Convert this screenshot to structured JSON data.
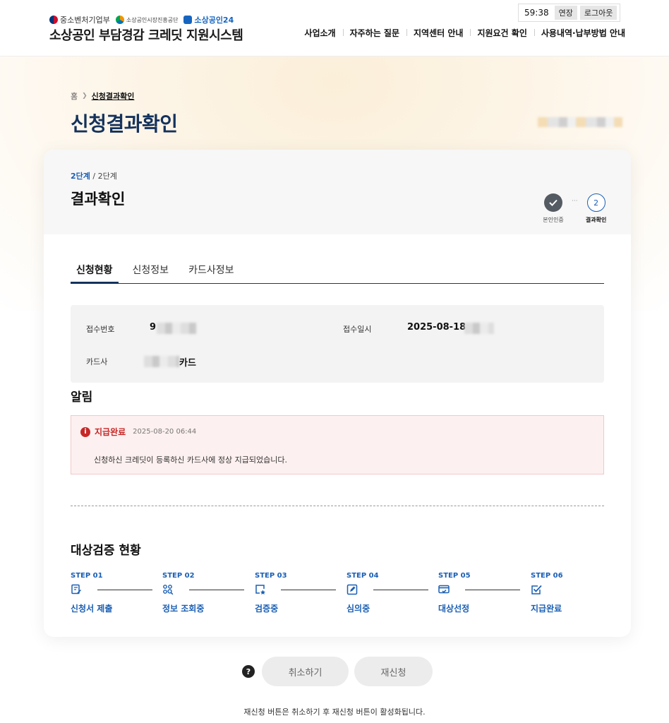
{
  "header": {
    "logos": {
      "ministry": "중소벤처기업부",
      "agency": "소상공인시장진흥공단",
      "portal": "소상공인24"
    },
    "site_title": "소상공인 부담경감 크레딧 지원시스템",
    "session": {
      "timer": "59:38",
      "extend_label": "연장",
      "logout_label": "로그아웃"
    },
    "nav": [
      {
        "label": "사업소개"
      },
      {
        "label": "자주하는 질문"
      },
      {
        "label": "지역센터 안내"
      },
      {
        "label": "지원요건 확인"
      },
      {
        "label": "사용내역·납부방법 안내"
      }
    ]
  },
  "breadcrumb": {
    "home": "홈",
    "current": "신청결과확인"
  },
  "page_title": "신청결과확인",
  "card": {
    "step_current": "2단계",
    "step_total": " / 2단계",
    "title": "결과확인",
    "progress": [
      {
        "label": "본인인증",
        "state": "done",
        "icon": "check-icon"
      },
      {
        "label": "결과확인",
        "state": "current",
        "number": "2"
      }
    ],
    "tabs": [
      {
        "label": "신청현황",
        "active": true
      },
      {
        "label": "신청정보",
        "active": false
      },
      {
        "label": "카드사정보",
        "active": false
      }
    ],
    "info": {
      "receipt_no_label": "접수번호",
      "receipt_no_value": "9",
      "receipt_date_label": "접수일시",
      "receipt_date_value": "2025-08-18",
      "card_company_label": "카드사",
      "card_company_value": "카드"
    },
    "notice": {
      "title": "알림",
      "status": "지급완료",
      "timestamp": "2025-08-20 06:44",
      "message": "신청하신 크레딧이 등록하신 카드사에 정상 지급되었습니다."
    },
    "verification": {
      "title": "대상검증 현황",
      "steps": [
        {
          "no": "STEP 01",
          "label": "신청서 제출",
          "icon": "document-edit-icon"
        },
        {
          "no": "STEP 02",
          "label": "정보 조회중",
          "icon": "search-grid-icon"
        },
        {
          "no": "STEP 03",
          "label": "검증중",
          "icon": "verify-star-icon"
        },
        {
          "no": "STEP 04",
          "label": "심의중",
          "icon": "pen-square-icon"
        },
        {
          "no": "STEP 05",
          "label": "대상선정",
          "icon": "card-check-icon"
        },
        {
          "no": "STEP 06",
          "label": "지급완료",
          "icon": "checkbox-icon"
        }
      ]
    }
  },
  "actions": {
    "help_symbol": "?",
    "cancel_label": "취소하기",
    "reapply_label": "재신청",
    "note": "재신청 버튼은 취소하기 후 재신청 버튼이 활성화됩니다."
  },
  "colors": {
    "primary": "#1a5fb4",
    "title_navy": "#14325c",
    "alert_red": "#c62828",
    "alert_bg": "#fdf0f0"
  }
}
